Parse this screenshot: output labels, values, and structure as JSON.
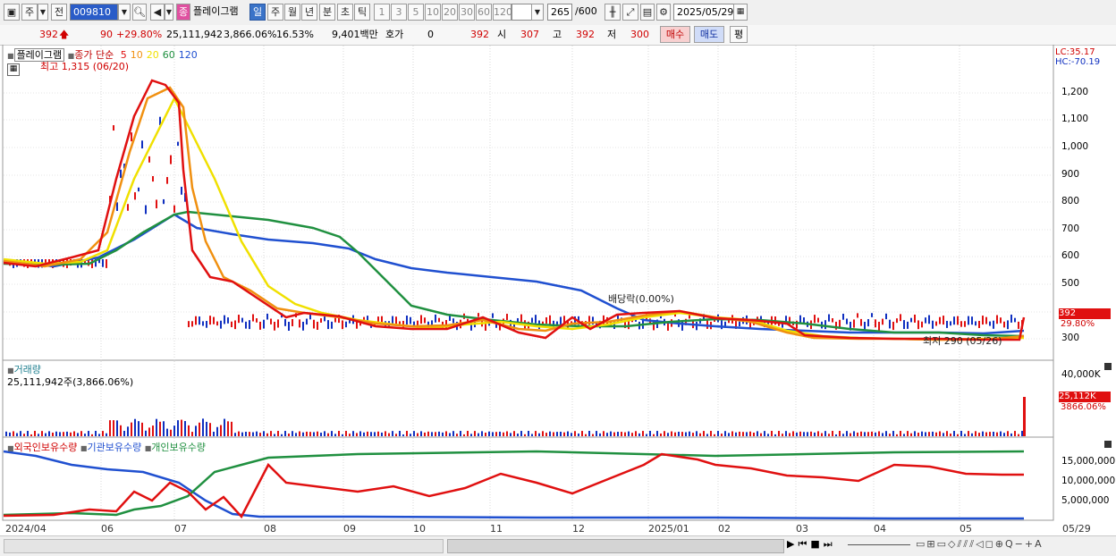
{
  "toolbar": {
    "market_label": "주",
    "prev_label": "전",
    "code": "009810",
    "name_badge": "종",
    "stock_name": "플레이그램",
    "periods": [
      "일",
      "주",
      "월",
      "년",
      "분",
      "초",
      "틱"
    ],
    "active_period": "일",
    "intervals": [
      "1",
      "3",
      "5",
      "10",
      "20",
      "30",
      "60",
      "120"
    ],
    "count": "265",
    "count_max": "/600",
    "date": "2025/05/29"
  },
  "quote": {
    "price": "392",
    "change": "90",
    "change_pct": "+29.80%",
    "volume": "25,111,942",
    "volume_pct": "3,866.06%",
    "turnover_pct": "16.53%",
    "amount": "9,401백만",
    "hoga_label": "호가",
    "hoga_value": "0",
    "hoga_price": "392",
    "open_label": "시",
    "open": "307",
    "high_label": "고",
    "high": "392",
    "low_label": "저",
    "low": "300",
    "buy_label": "매수",
    "sell_label": "매도",
    "avg_label": "평"
  },
  "price_panel": {
    "legend_name": "플레이그램",
    "legend_ma": "종가 단순",
    "ma_periods": [
      {
        "label": "5",
        "color": "#e01010"
      },
      {
        "label": "10",
        "color": "#f09010"
      },
      {
        "label": "20",
        "color": "#f0e000"
      },
      {
        "label": "60",
        "color": "#209040"
      },
      {
        "label": "120",
        "color": "#2050d0"
      }
    ],
    "high_note": "최고 1,315 (06/20)",
    "low_note": "최저 290 (05/26)",
    "dividend_note": "배당락(0.00%)",
    "lc": "LC:35.17",
    "hc": "HC:-70.19",
    "y_ticks": [
      "1,200",
      "1,100",
      "1,000",
      "900",
      "800",
      "700",
      "600",
      "500",
      "300"
    ],
    "last_price_tag": "392",
    "last_pct_tag": "29.80%"
  },
  "volume_panel": {
    "title": "거래량",
    "value": "25,111,942주(3,866.06%)",
    "y_tick": "40,000K",
    "last_tag": "25,112K",
    "last_pct": "3866.06%"
  },
  "holding_panel": {
    "legend": [
      "외국인보유수량",
      "기관보유수량",
      "개인보유수량"
    ],
    "y_ticks": [
      "15,000,000",
      "10,000,000",
      "5,000,000"
    ]
  },
  "x_axis": [
    "2024/04",
    "06",
    "07",
    "08",
    "09",
    "10",
    "11",
    "12",
    "2025/01",
    "02",
    "03",
    "04",
    "05",
    "05/29"
  ],
  "colors": {
    "ma5": "#e01010",
    "ma10": "#f09010",
    "ma20": "#f0e000",
    "ma60": "#209040",
    "ma120": "#2050d0",
    "up": "#e01010",
    "down": "#1030c0"
  }
}
